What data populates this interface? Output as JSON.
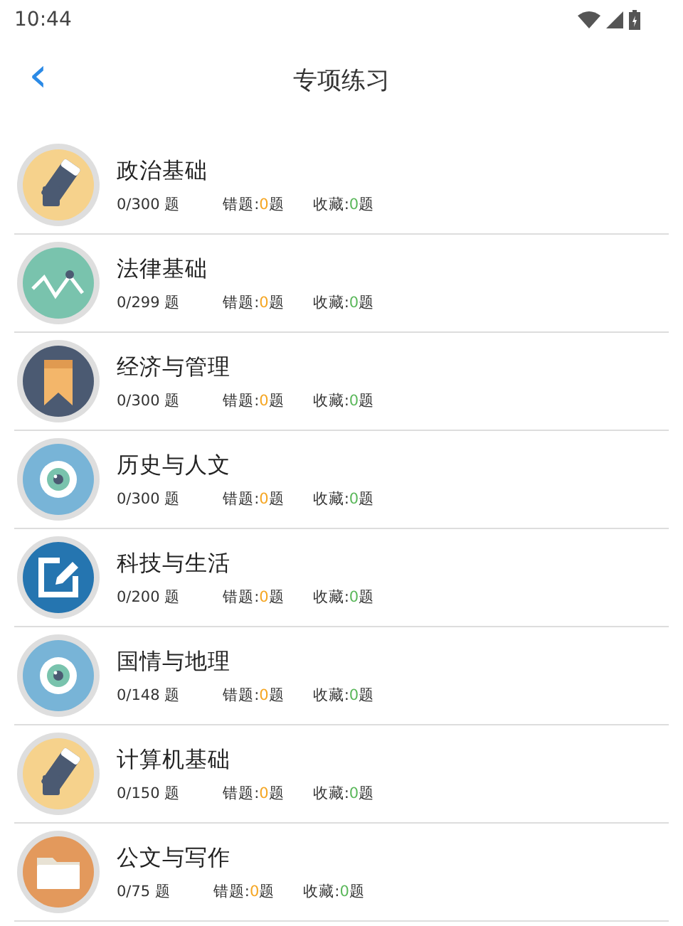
{
  "status_bar": {
    "time": "10:44"
  },
  "header": {
    "back": "‹",
    "title": "专项练习"
  },
  "items": [
    {
      "kind": "eraser",
      "title": "政治基础",
      "progress": "0/300 题",
      "wrong": {
        "label": "错题:",
        "count": "0",
        "unit": "题"
      },
      "favorites": {
        "label": "收藏:",
        "count": "0",
        "unit": "题"
      }
    },
    {
      "kind": "chart",
      "title": "法律基础",
      "progress": "0/299 题",
      "wrong": {
        "label": "错题:",
        "count": "0",
        "unit": "题"
      },
      "favorites": {
        "label": "收藏:",
        "count": "0",
        "unit": "题"
      }
    },
    {
      "kind": "bookmark",
      "title": "经济与管理",
      "progress": "0/300 题",
      "wrong": {
        "label": "错题:",
        "count": "0",
        "unit": "题"
      },
      "favorites": {
        "label": "收藏:",
        "count": "0",
        "unit": "题"
      }
    },
    {
      "kind": "eye",
      "title": "历史与人文",
      "progress": "0/300 题",
      "wrong": {
        "label": "错题:",
        "count": "0",
        "unit": "题"
      },
      "favorites": {
        "label": "收藏:",
        "count": "0",
        "unit": "题"
      }
    },
    {
      "kind": "edit",
      "title": "科技与生活",
      "progress": "0/200 题",
      "wrong": {
        "label": "错题:",
        "count": "0",
        "unit": "题"
      },
      "favorites": {
        "label": "收藏:",
        "count": "0",
        "unit": "题"
      }
    },
    {
      "kind": "eye",
      "title": "国情与地理",
      "progress": "0/148 题",
      "wrong": {
        "label": "错题:",
        "count": "0",
        "unit": "题"
      },
      "favorites": {
        "label": "收藏:",
        "count": "0",
        "unit": "题"
      }
    },
    {
      "kind": "eraser",
      "title": "计算机基础",
      "progress": "0/150 题",
      "wrong": {
        "label": "错题:",
        "count": "0",
        "unit": "题"
      },
      "favorites": {
        "label": "收藏:",
        "count": "0",
        "unit": "题"
      }
    },
    {
      "kind": "folder",
      "title": "公文与写作",
      "progress": "0/75 题",
      "wrong": {
        "label": "错题:",
        "count": "0",
        "unit": "题"
      },
      "favorites": {
        "label": "收藏:",
        "count": "0",
        "unit": "题"
      }
    }
  ]
}
